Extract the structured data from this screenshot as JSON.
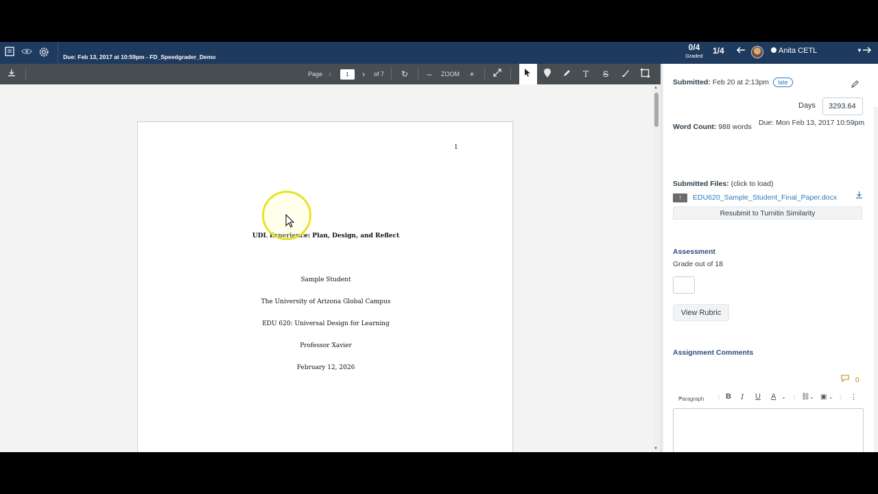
{
  "header": {
    "due_text": "Due: Feb 13, 2017 at 10:59pm - FD_Speedgrader_Demo",
    "graded_count": "0/4",
    "graded_label": "Graded",
    "position": "1/4",
    "student_name": "Anita CETL",
    "icons": [
      "gradebook-icon",
      "eye-icon",
      "gear-icon",
      "arrow-left-icon",
      "chevron-down-icon",
      "arrow-right-icon"
    ]
  },
  "doc_toolbar": {
    "page_label": "Page",
    "page_value": "1",
    "page_of": "of 7",
    "zoom_label": "ZOOM",
    "icons": [
      "download-icon",
      "prev-page-icon",
      "next-page-icon",
      "rotate-icon",
      "zoom-out-icon",
      "zoom-in-icon",
      "fullscreen-icon",
      "pointer-icon",
      "point-annotation-icon",
      "highlight-icon",
      "text-icon",
      "strikeout-icon",
      "draw-icon",
      "area-icon"
    ]
  },
  "document": {
    "page_number": "1",
    "title": "UDL Experience: Plan, Design, and Reflect",
    "lines": [
      "Sample Student",
      "The University of Arizona Global Campus",
      "EDU 620: Universal Design for Learning",
      "Professor Xavier",
      "February 12, 2026"
    ]
  },
  "panel": {
    "submitted_label": "Submitted:",
    "submitted_value": "Feb 20 at 2:13pm",
    "late_badge": "late",
    "days_label": "Days",
    "days_value": "3293.64",
    "word_count_label": "Word Count:",
    "word_count_value": "988 words",
    "due_text": "Due: Mon Feb 13, 2017 10:59pm",
    "submitted_files_label": "Submitted Files:",
    "submitted_files_hint": "(click to load)",
    "file_name": "EDU620_Sample_Student_Final_Paper.docx",
    "file_badge": "!",
    "resubmit_label": "Resubmit to Turnitin Similarity",
    "assessment_heading": "Assessment",
    "grade_out_of": "Grade out of 18",
    "view_rubric": "View Rubric",
    "comments_heading": "Assignment Comments",
    "comment_count": "0",
    "editor_block_format": "Paragraph"
  },
  "colors": {
    "header_bg": "#1f3a5f",
    "toolbar_bg": "#474d51",
    "link": "#2b7abc",
    "highlight_ring": "#e8e227"
  }
}
